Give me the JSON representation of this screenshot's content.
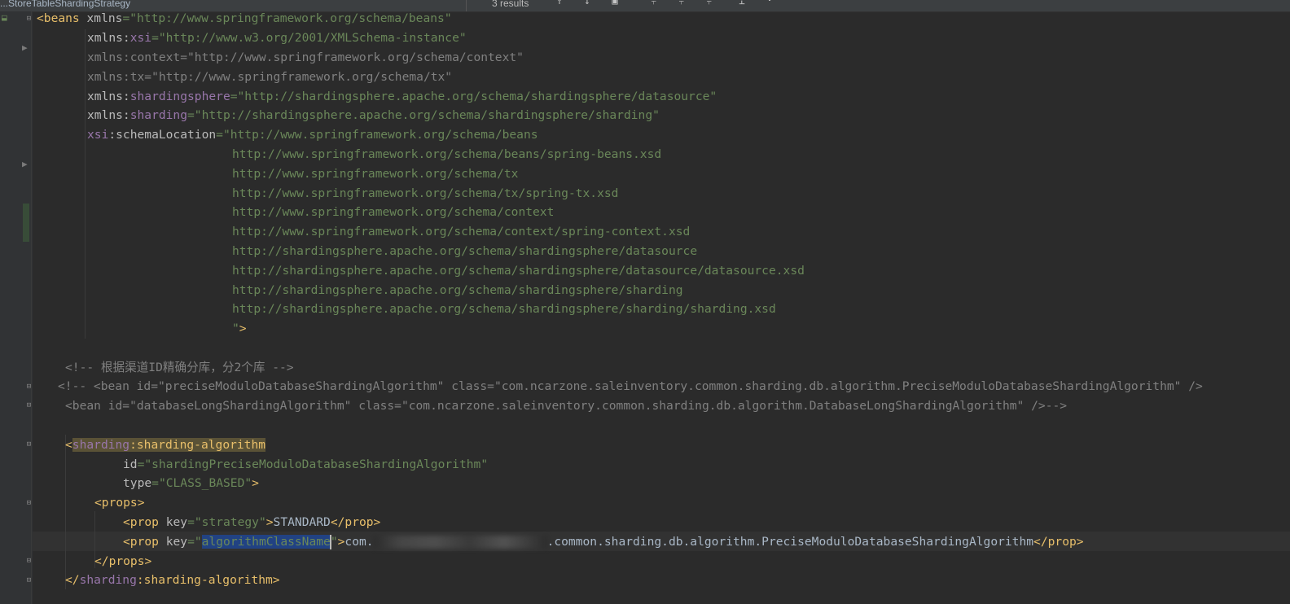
{
  "toolbar": {
    "search_text": "...StoreTableShardingStrategy",
    "results": "3 results"
  },
  "code": {
    "l1_tag": "<beans",
    "l1_attr": " xmlns",
    "l1_val": "=\"http://www.springframework.org/schema/beans\"",
    "l2_attr": "xmlns:",
    "l2_ns": "xsi",
    "l2_val": "=\"http://www.w3.org/2001/XMLSchema-instance\"",
    "l3": "xmlns:context=\"http://www.springframework.org/schema/context\"",
    "l4": "xmlns:tx=\"http://www.springframework.org/schema/tx\"",
    "l5_attr": "xmlns:",
    "l5_ns": "shardingsphere",
    "l5_val": "=\"http://shardingsphere.apache.org/schema/shardingsphere/datasource\"",
    "l6_attr": "xmlns:",
    "l6_ns": "sharding",
    "l6_val": "=\"http://shardingsphere.apache.org/schema/shardingsphere/sharding\"",
    "l7_ns": "xsi",
    "l7_attr": ":schemaLocation",
    "l7_val": "=\"http://www.springframework.org/schema/beans",
    "schema_urls": [
      "http://www.springframework.org/schema/beans/spring-beans.xsd",
      "http://www.springframework.org/schema/tx",
      "http://www.springframework.org/schema/tx/spring-tx.xsd",
      "http://www.springframework.org/schema/context",
      "http://www.springframework.org/schema/context/spring-context.xsd",
      "http://shardingsphere.apache.org/schema/shardingsphere/datasource",
      "http://shardingsphere.apache.org/schema/shardingsphere/datasource/datasource.xsd",
      "http://shardingsphere.apache.org/schema/shardingsphere/sharding",
      "http://shardingsphere.apache.org/schema/shardingsphere/sharding/sharding.xsd"
    ],
    "l17_val": "\"",
    "l17_tag": ">",
    "comment1": "<!-- 根据渠道ID精确分库，分2个库 -->",
    "comment2": "<!-- <bean id=\"preciseModuloDatabaseShardingAlgorithm\" class=\"com.ncarzone.saleinventory.common.sharding.db.algorithm.PreciseModuloDatabaseShardingAlgorithm\" />",
    "comment3": "<bean id=\"databaseLongShardingAlgorithm\" class=\"com.ncarzone.saleinventory.common.sharding.db.algorithm.DatabaseLongShardingAlgorithm\" />-->",
    "algo_open_lt": "<",
    "algo_ns": "sharding",
    "algo_name": ":sharding-algorithm",
    "id_attr": "id",
    "id_val": "=\"shardingPreciseModuloDatabaseShardingAlgorithm\"",
    "type_attr": "type",
    "type_val": "=\"CLASS_BASED\"",
    "type_close": ">",
    "props_open": "<props>",
    "prop1_tag": "<prop",
    "prop1_attr": " key",
    "prop1_val": "=\"strategy\"",
    "prop1_gt": ">",
    "prop1_text": "STANDARD",
    "prop1_close": "</prop>",
    "prop2_tag": "<prop",
    "prop2_attr": " key",
    "prop2_q1": "=\"",
    "prop2_sel": "algorithmClassName",
    "prop2_q2": "\"",
    "prop2_gt": ">",
    "prop2_text_a": "com.",
    "prop2_text_b": ".common.sharding.db.algorithm.PreciseModuloDatabaseShardingAlgorithm",
    "prop2_close": "</prop>",
    "props_close": "</props>",
    "algo_close_lt": "</",
    "algo_close_ns": "sharding",
    "algo_close_name": ":sharding-algorithm>"
  }
}
